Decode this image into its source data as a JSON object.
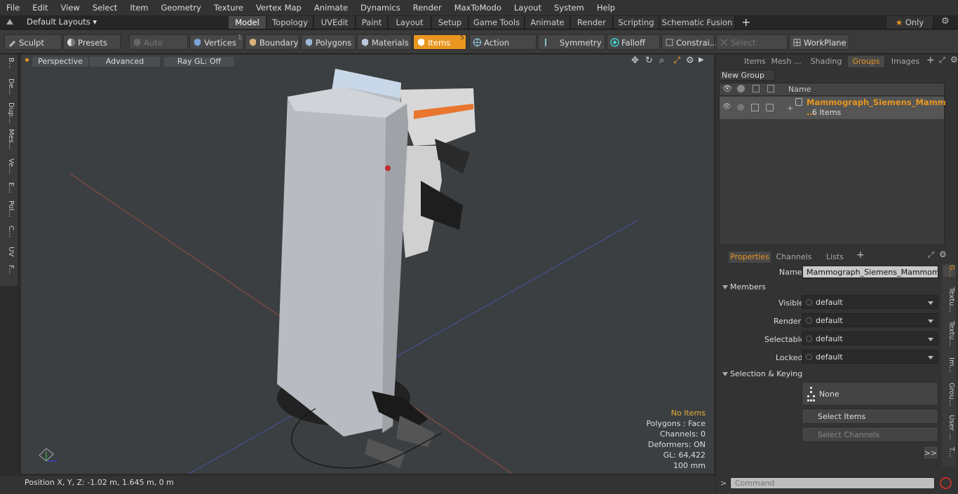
{
  "menu": [
    "File",
    "Edit",
    "View",
    "Select",
    "Item",
    "Geometry",
    "Texture",
    "Vertex Map",
    "Animate",
    "Dynamics",
    "Render",
    "MaxToModo",
    "Layout",
    "System",
    "Help"
  ],
  "layouts": {
    "selector": "Default Layouts",
    "tabs": [
      "Model",
      "Topology",
      "UVEdit",
      "Paint",
      "Layout",
      "Setup",
      "Game Tools",
      "Animate",
      "Render",
      "Scripting",
      "Schematic Fusion"
    ],
    "active_tab": "Model",
    "only_label": "Only"
  },
  "toolbar": {
    "sculpt": "Sculpt",
    "presets": "Presets",
    "auto_select": "Auto Select",
    "vertices": "Vertices",
    "vertices_count": "1",
    "boundary": "Boundary",
    "polygons": "Polygons",
    "materials": "Materials",
    "items": "Items",
    "items_count": "5",
    "action_center": "Action Center",
    "symmetry": "Symmetry",
    "falloff": "Falloff",
    "constraints": "Constrai...",
    "select_through": "Select Through",
    "workplane": "WorkPlane"
  },
  "left_tabs": [
    "B...",
    "De...",
    "Dup...",
    "Mes...",
    "Ve...",
    "E...",
    "Pol...",
    "C...",
    "UV",
    "F..."
  ],
  "viewport": {
    "view": "Perspective",
    "shading": "Advanced",
    "raygl": "Ray GL: Off",
    "stats": {
      "no_items": "No Items",
      "polygons": "Polygons : Face",
      "channels": "Channels: 0",
      "deformers": "Deformers: ON",
      "gl": "GL: 64,422",
      "scale": "100 mm"
    }
  },
  "status": "Position X, Y, Z:   -1.02 m, 1.645 m, 0 m",
  "groups_panel": {
    "tabs": [
      "Items",
      "Mesh ...",
      "Shading",
      "Groups",
      "Images"
    ],
    "active_tab": "Groups",
    "new_group": "New Group",
    "col_name": "Name",
    "group_name": "Mammograph_Siemens_Mamm ...",
    "group_count": "6 Items"
  },
  "properties": {
    "tabs": [
      "Properties",
      "Channels",
      "Lists"
    ],
    "active_tab": "Properties",
    "name_label": "Name",
    "name_value": "Mammograph_Siemens_Mammomat_R",
    "members": "Members",
    "visible_label": "Visible",
    "visible": "default",
    "render_label": "Render",
    "render": "default",
    "selectable_label": "Selectable",
    "selectable": "default",
    "locked_label": "Locked",
    "locked": "default",
    "sel_keying": "Selection & Keying",
    "none": "None",
    "select_items": "Select Items",
    "select_channels": "Select Channels",
    "more": ">>"
  },
  "side_tabs": [
    "G...",
    "Textu...",
    "Textu...",
    "Im...",
    "Grou...",
    "User ...",
    "T..."
  ],
  "command_placeholder": "Command",
  "colors": {
    "accent": "#e8961f",
    "viewport": "#3b3f41",
    "panel": "#333333"
  }
}
